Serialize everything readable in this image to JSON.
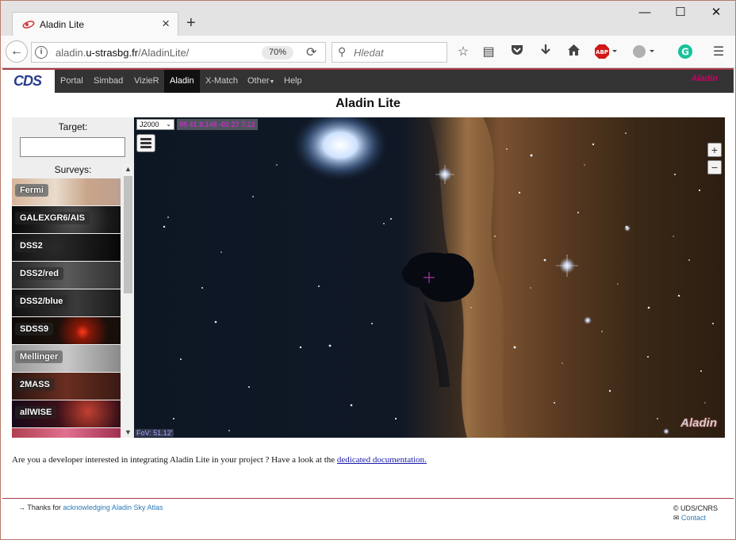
{
  "browser": {
    "tab_title": "Aladin Lite",
    "url_prefix": "aladin.",
    "url_domain": "u-strasbg.fr",
    "url_path": "/AladinLite/",
    "zoom": "70%",
    "search_placeholder": "Hledat",
    "abp_label": "ABP"
  },
  "site": {
    "logo_text": "CDS",
    "nav": [
      "Portal",
      "Simbad",
      "VizieR",
      "Aladin",
      "X-Match",
      "Other",
      "Help"
    ],
    "active_nav": "Aladin",
    "mini_logo": "Aladin"
  },
  "page": {
    "title": "Aladin Lite"
  },
  "panel": {
    "target_label": "Target:",
    "target_value": "",
    "surveys_label": "Surveys:",
    "surveys": [
      "Fermi",
      "GALEXGR6/AIS",
      "DSS2",
      "DSS2/red",
      "DSS2/blue",
      "SDSS9",
      "Mellinger",
      "2MASS",
      "allWISE"
    ]
  },
  "sky": {
    "frame": "J2000",
    "coordinates": "05 41 8.148 -02 27 7.12",
    "fov": "FoV: 51.12'",
    "logo": "Aladin",
    "zoom_in": "+",
    "zoom_out": "−"
  },
  "developer": {
    "text": "Are you a developer interested in integrating Aladin Lite in your project ? Have a look at the",
    "link": "dedicated documentation."
  },
  "footer": {
    "thanks_prefix": "Thanks for",
    "thanks_link": "acknowledging Aladin Sky Atlas",
    "copyright": "© UDS/CNRS",
    "contact": "Contact"
  }
}
